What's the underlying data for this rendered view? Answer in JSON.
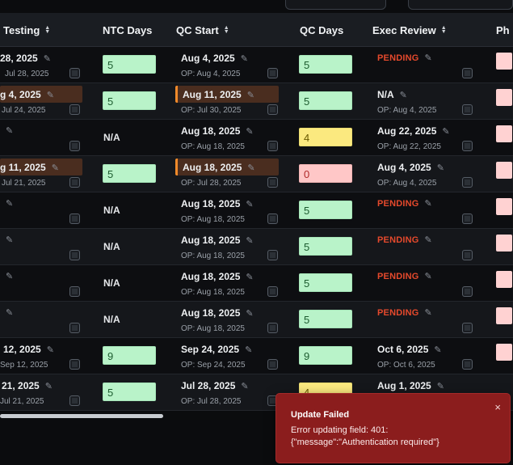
{
  "columns": {
    "testing": "Testing",
    "ntc_days": "NTC Days",
    "qc_start": "QC Start",
    "qc_days": "QC Days",
    "exec_review": "Exec Review",
    "ph_partial": "Ph"
  },
  "colors": {
    "pending": "#e5492c",
    "toast_bg": "#8b1d1d",
    "badge_green": "#b9f3c9",
    "badge_yellow": "#fbe97f",
    "badge_red": "#ffc7c7"
  },
  "rows": [
    {
      "testing": {
        "date": "28, 2025",
        "op": "Jul 28, 2025"
      },
      "ntc": "5",
      "qc_start": {
        "date": "Aug 4, 2025",
        "op": "OP: Aug 4, 2025"
      },
      "qc_days": "5",
      "exec": {
        "pending": "PENDING"
      }
    },
    {
      "testing": {
        "date": "g 4, 2025",
        "op": "Jul 24, 2025"
      },
      "ntc": "5",
      "qc_start": {
        "date": "Aug 11, 2025",
        "op": "OP: Jul 30, 2025"
      },
      "qc_days": "5",
      "exec": {
        "date": "N/A",
        "op": "OP: Aug 4, 2025"
      }
    },
    {
      "ntc_na": "N/A",
      "qc_start": {
        "date": "Aug 18, 2025",
        "op": "OP: Aug 18, 2025"
      },
      "qc_days": "4",
      "exec": {
        "date": "Aug 22, 2025",
        "op": "OP: Aug 22, 2025"
      }
    },
    {
      "testing": {
        "date": "g 11, 2025",
        "op": "Jul 21, 2025"
      },
      "ntc": "5",
      "qc_start": {
        "date": "Aug 18, 2025",
        "op": "OP: Jul 28, 2025"
      },
      "qc_days": "0",
      "exec": {
        "date": "Aug 4, 2025",
        "op": "OP: Aug 4, 2025"
      }
    },
    {
      "ntc_na": "N/A",
      "qc_start": {
        "date": "Aug 18, 2025",
        "op": "OP: Aug 18, 2025"
      },
      "qc_days": "5",
      "exec": {
        "pending": "PENDING"
      }
    },
    {
      "ntc_na": "N/A",
      "qc_start": {
        "date": "Aug 18, 2025",
        "op": "OP: Aug 18, 2025"
      },
      "qc_days": "5",
      "exec": {
        "pending": "PENDING"
      }
    },
    {
      "ntc_na": "N/A",
      "qc_start": {
        "date": "Aug 18, 2025",
        "op": "OP: Aug 18, 2025"
      },
      "qc_days": "5",
      "exec": {
        "pending": "PENDING"
      }
    },
    {
      "ntc_na": "N/A",
      "qc_start": {
        "date": "Aug 18, 2025",
        "op": "OP: Aug 18, 2025"
      },
      "qc_days": "5",
      "exec": {
        "pending": "PENDING"
      }
    },
    {
      "testing": {
        "date": "12, 2025",
        "op": "Sep 12, 2025"
      },
      "ntc": "9",
      "qc_start": {
        "date": "Sep 24, 2025",
        "op": "OP: Sep 24, 2025"
      },
      "qc_days": "9",
      "exec": {
        "date": "Oct 6, 2025",
        "op": "OP: Oct 6, 2025"
      }
    },
    {
      "testing": {
        "date": "21, 2025",
        "op": "Jul 21, 2025"
      },
      "ntc": "5",
      "qc_start": {
        "date": "Jul 28, 2025",
        "op": "OP: Jul 28, 2025"
      },
      "qc_days": "4",
      "exec": {
        "date": "Aug 1, 2025"
      }
    }
  ],
  "toast": {
    "title": "Update Failed",
    "line1": "Error updating field: 401:",
    "line2": "{\"message\":\"Authentication required\"}",
    "close": "×"
  }
}
